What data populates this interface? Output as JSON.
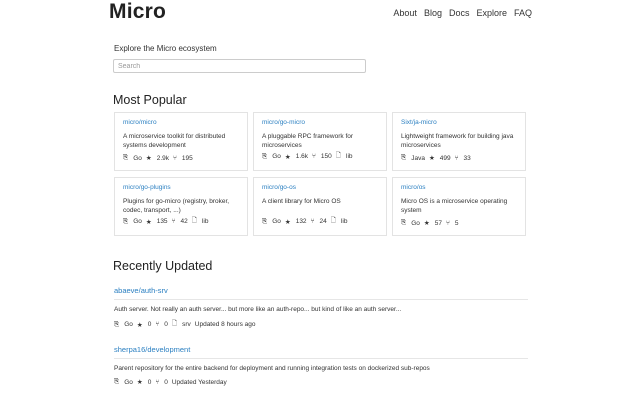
{
  "header": {
    "brand": "Micro",
    "nav": [
      "About",
      "Blog",
      "Docs",
      "Explore",
      "FAQ"
    ]
  },
  "explore": {
    "title": "Explore the Micro ecosystem",
    "search_placeholder": "Search"
  },
  "popular": {
    "title": "Most Popular",
    "cards": [
      {
        "name": "micro/micro",
        "desc": "A microservice toolkit for distributed systems development",
        "lang": "Go",
        "stars": "2.9k",
        "forks": "195",
        "type": ""
      },
      {
        "name": "micro/go-micro",
        "desc": "A pluggable RPC framework for microservices",
        "lang": "Go",
        "stars": "1.6k",
        "forks": "150",
        "type": "lib"
      },
      {
        "name": "Sixt/ja-micro",
        "desc": "Lightweight framework for building java microservices",
        "lang": "Java",
        "stars": "499",
        "forks": "33",
        "type": ""
      },
      {
        "name": "micro/go-plugins",
        "desc": "Plugins for go-micro (registry, broker, codec, transport, ...)",
        "lang": "Go",
        "stars": "135",
        "forks": "42",
        "type": "lib"
      },
      {
        "name": "micro/go-os",
        "desc": "A client library for Micro OS",
        "lang": "Go",
        "stars": "132",
        "forks": "24",
        "type": "lib"
      },
      {
        "name": "micro/os",
        "desc": "Micro OS is a microservice operating system",
        "lang": "Go",
        "stars": "57",
        "forks": "5",
        "type": ""
      }
    ]
  },
  "recent": {
    "title": "Recently Updated",
    "items": [
      {
        "name": "abaeve/auth-srv",
        "desc": "Auth server. Not really an auth server... but more like an auth-repo... but kind of like an auth server...",
        "lang": "Go",
        "stars": "0",
        "forks": "0",
        "type": "srv",
        "updated": "Updated 8 hours ago"
      },
      {
        "name": "sherpa16/development",
        "desc": "Parent repository for the entire backend for deployment and running integration tests on dockerized sub-repos",
        "lang": "Go",
        "stars": "0",
        "forks": "0",
        "type": "",
        "updated": "Updated Yesterday"
      }
    ]
  },
  "icons": {
    "lang": "⎘",
    "star": "★",
    "fork": "⑂",
    "file": "🗋"
  }
}
